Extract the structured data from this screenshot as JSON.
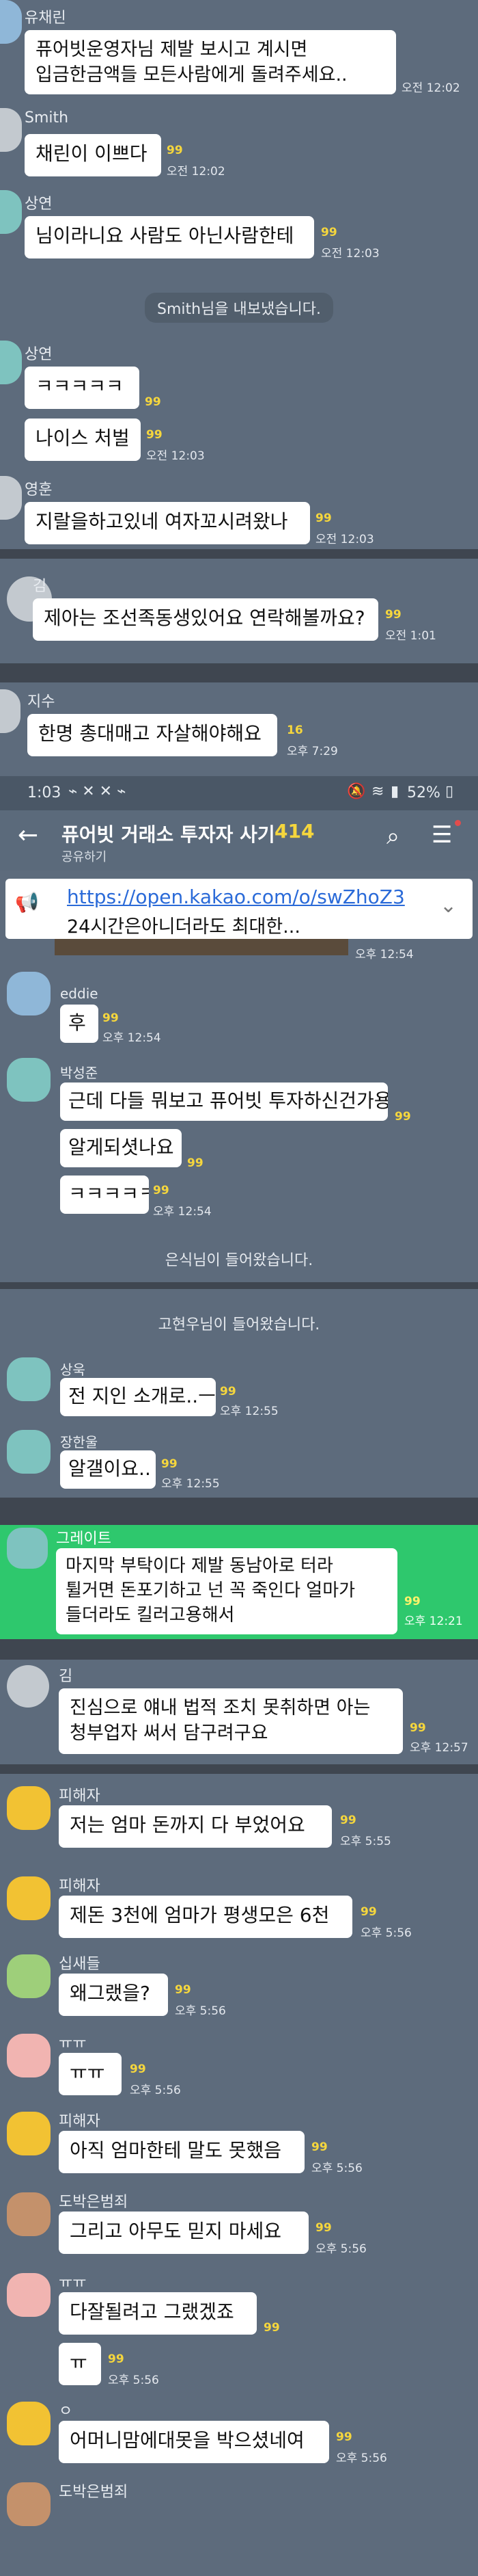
{
  "segment1": {
    "messages": [
      {
        "name": "유채린",
        "text": "퓨어빗운영자님 제발 보시고 계시면\n입금한금액들 모든사람에게 돌려주세요..",
        "unread": "",
        "time": "오전 12:02"
      },
      {
        "name": "Smith",
        "text": "채린이 이쁘다",
        "unread": "99",
        "time": "오전 12:02"
      },
      {
        "name": "상연",
        "text": "님이라니요 사람도 아닌사람한테",
        "unread": "99",
        "time": "오전 12:03"
      },
      {
        "name": "상연",
        "text": "ㅋㅋㅋㅋㅋ",
        "unread": "99",
        "time": ""
      },
      {
        "name": "",
        "text": "나이스 처벌",
        "unread": "99",
        "time": "오전 12:03"
      },
      {
        "name": "영훈",
        "text": "지랄을하고있네 여자꼬시려왔나",
        "unread": "99",
        "time": "오전 12:03"
      }
    ],
    "system": "Smith님을 내보냈습니다."
  },
  "segment2": {
    "name": "김",
    "text": "제아는 조선족동생있어요 연락해볼까요?",
    "unread": "99",
    "time": "오전 1:01"
  },
  "segment3": {
    "name": "지수",
    "text": "한명 총대매고 자살해야해요",
    "unread": "16",
    "time": "오후 7:29"
  },
  "status_bar": {
    "time": "1:03",
    "battery": "52%"
  },
  "app_bar": {
    "title": "퓨어빗 거래소 투자자 사기",
    "count": "414",
    "subtitle": "공유하기"
  },
  "notice": {
    "link": "https://open.kakao.com/o/swZhoZ3",
    "text": "24시간은아니더라도 최대한..."
  },
  "segment4": {
    "time_top": "오후 12:54",
    "messages": [
      {
        "name": "eddie",
        "text": "후",
        "unread": "99",
        "time": "오후 12:54"
      },
      {
        "name": "박성준",
        "text": "근데 다들 뭐보고 퓨어빗 투자하신건가용",
        "unread": "99",
        "time": ""
      },
      {
        "name": "",
        "text": "알게되셧나요",
        "unread": "99",
        "time": ""
      },
      {
        "name": "",
        "text": "ㅋㅋㅋㅋㅋ",
        "unread": "99",
        "time": "오후 12:54"
      },
      {
        "name": "상욱",
        "text": "전 지인 소개로..ㅡ",
        "unread": "99",
        "time": "오후 12:55"
      },
      {
        "name": "장한울",
        "text": "알갤이요..",
        "unread": "99",
        "time": "오후 12:55"
      }
    ],
    "system1": "은식님이 들어왔습니다.",
    "system2": "고현우님이 들어왔습니다."
  },
  "segment5": {
    "name": "그레이트",
    "text": "마지막 부탁이다  제발 동남아로 터라\n튈거면  돈포기하고 넌 꼭 죽인다 얼마가\n들더라도 킬러고용해서",
    "unread": "99",
    "time": "오후 12:21"
  },
  "segment6": {
    "name": "김",
    "text": "진심으로 얘내 법적 조치 못취하면 아는\n청부업자 써서 담구려구요",
    "unread": "99",
    "time": "오후 12:57"
  },
  "segment7": {
    "messages": [
      {
        "name": "피해자",
        "text": "저는 엄마 돈까지 다 부었어요",
        "unread": "99",
        "time": "오후 5:55"
      },
      {
        "name": "피해자",
        "text": "제돈 3천에 엄마가 평생모은 6천",
        "unread": "99",
        "time": "오후 5:56"
      },
      {
        "name": "십새들",
        "text": "왜그랬을?",
        "unread": "99",
        "time": "오후 5:56"
      },
      {
        "name": "ㅠㅠ",
        "text": "ㅠㅠ",
        "unread": "99",
        "time": "오후 5:56"
      },
      {
        "name": "피해자",
        "text": "아직 엄마한테 말도 못했음",
        "unread": "99",
        "time": "오후 5:56"
      },
      {
        "name": "도박은범죄",
        "text": "그리고 아무도 믿지 마세요",
        "unread": "99",
        "time": "오후 5:56"
      },
      {
        "name": "ㅠㅠ",
        "text": "다잘될려고 그랬겠죠",
        "unread": "99",
        "time": ""
      },
      {
        "name": "",
        "text": "ㅠ",
        "unread": "99",
        "time": "오후 5:56"
      },
      {
        "name": "ㅇ",
        "text": "어머니맘에대못을 박으셨네여",
        "unread": "99",
        "time": "오후 5:56"
      },
      {
        "name": "도박은범죄",
        "text": "",
        "unread": "",
        "time": ""
      }
    ]
  },
  "colors": {
    "chat_bg": "#5d6b7c",
    "divider": "#3f4650",
    "green_bg": "#2ec86d",
    "unread": "#f5d63d",
    "app_bar": "#5b6a7b"
  }
}
